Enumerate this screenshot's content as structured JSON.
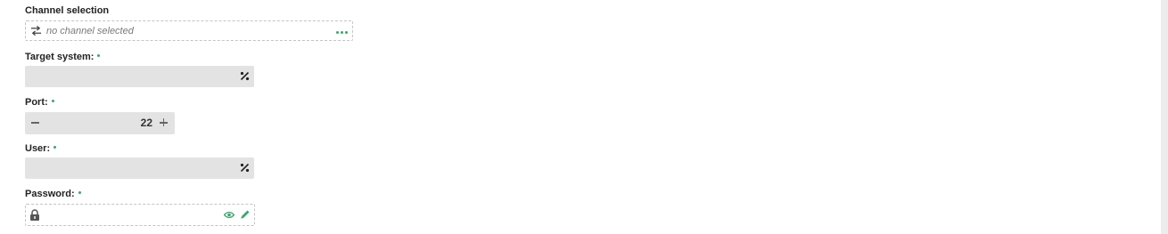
{
  "channel": {
    "label": "Channel selection",
    "placeholder": "no channel selected",
    "channel_icon": "swap-arrows-icon",
    "more_icon": "more-dots-icon"
  },
  "target_system": {
    "label": "Target system:",
    "required": true,
    "value": "",
    "action_icon": "variable-icon"
  },
  "port": {
    "label": "Port:",
    "required": true,
    "value": "22",
    "decrement_icon": "minus-icon",
    "increment_icon": "plus-icon"
  },
  "user": {
    "label": "User:",
    "required": true,
    "value": "",
    "action_icon": "variable-icon"
  },
  "password": {
    "label": "Password:",
    "required": true,
    "value": "",
    "lock_icon": "lock-icon",
    "reveal_icon": "eye-icon",
    "edit_icon": "pencil-icon"
  },
  "colors": {
    "accent": "#3aa76d",
    "input_bg": "#e3e3e3",
    "dashed_border": "#c4c4c4"
  }
}
